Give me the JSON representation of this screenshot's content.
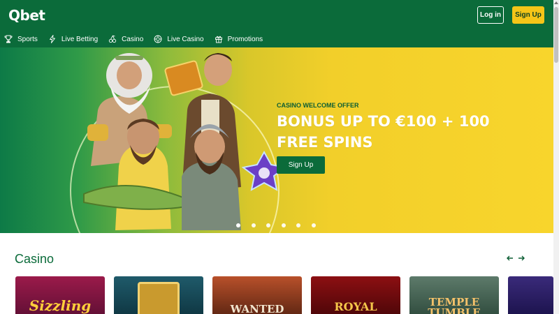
{
  "header": {
    "logo": "Qbet",
    "login_label": "Log in",
    "signup_label": "Sign Up"
  },
  "nav": [
    {
      "label": "Sports",
      "icon": "trophy-icon"
    },
    {
      "label": "Live Betting",
      "icon": "lightning-icon"
    },
    {
      "label": "Casino",
      "icon": "cherries-icon"
    },
    {
      "label": "Live Casino",
      "icon": "roulette-chip-icon"
    },
    {
      "label": "Promotions",
      "icon": "gift-icon"
    }
  ],
  "hero": {
    "kicker": "CASINO WELCOME OFFER",
    "title": "BONUS UP TO €100 + 100 FREE SPINS",
    "cta_label": "Sign Up",
    "slide_count": 6,
    "active_slide": 1
  },
  "casino": {
    "title": "Casino",
    "prev_icon": "arrow-left-icon",
    "next_icon": "arrow-right-icon",
    "games": [
      {
        "label": "Sizzling"
      },
      {
        "label": ""
      },
      {
        "label": "WANTED"
      },
      {
        "label": "ROYAL"
      },
      {
        "label": "TEMPLE TUMBLE"
      },
      {
        "label": ""
      }
    ]
  },
  "colors": {
    "brand_green": "#0b6b3a",
    "accent_yellow": "#f5c518",
    "banner_yellow": "#f8d52c"
  }
}
